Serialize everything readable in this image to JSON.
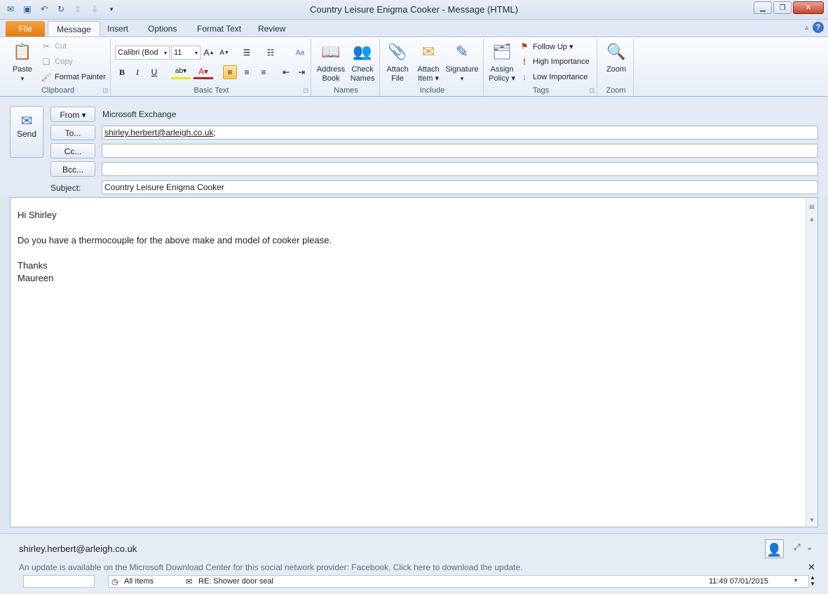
{
  "window": {
    "title": "Country Leisure Enigma Cooker  -  Message (HTML)"
  },
  "qat": {
    "icons": [
      "outlook-icon",
      "save-icon",
      "undo-icon",
      "redo-icon",
      "up-icon",
      "down-icon",
      "customize-icon"
    ]
  },
  "tabs": [
    {
      "label": "File"
    },
    {
      "label": "Message"
    },
    {
      "label": "Insert"
    },
    {
      "label": "Options"
    },
    {
      "label": "Format Text"
    },
    {
      "label": "Review"
    }
  ],
  "ribbon": {
    "clipboard": {
      "paste": "Paste",
      "cut": "Cut",
      "copy": "Copy",
      "format_painter": "Format Painter",
      "label": "Clipboard"
    },
    "basic_text": {
      "font": "Calibri (Bod",
      "size": "11",
      "label": "Basic Text"
    },
    "names": {
      "address_book_1": "Address",
      "address_book_2": "Book",
      "check_names_1": "Check",
      "check_names_2": "Names",
      "label": "Names"
    },
    "include": {
      "attach_file_1": "Attach",
      "attach_file_2": "File",
      "attach_item_1": "Attach",
      "attach_item_2": "Item ▾",
      "signature": "Signature",
      "label": "Include"
    },
    "tags": {
      "assign_policy_1": "Assign",
      "assign_policy_2": "Policy ▾",
      "follow_up": "Follow Up ▾",
      "high_importance": "High Importance",
      "low_importance": "Low Importance",
      "label": "Tags"
    },
    "zoom": {
      "zoom": "Zoom",
      "label": "Zoom"
    }
  },
  "compose": {
    "send": "Send",
    "from_button": "From ▾",
    "from_value": "Microsoft Exchange",
    "to_button": "To...",
    "to_value": "shirley.herbert@arleigh.co.uk",
    "to_suffix": ";",
    "cc_button": "Cc...",
    "cc_value": "",
    "bcc_button": "Bcc...",
    "bcc_value": "",
    "subject_label": "Subject:",
    "subject_value": "Country Leisure Enigma Cooker"
  },
  "body": {
    "lines": [
      "Hi Shirley",
      "",
      "Do you have a thermocouple for the above make and  model of cooker please.",
      "",
      "Thanks",
      "Maureen"
    ]
  },
  "people_pane": {
    "name": "shirley.herbert@arleigh.co.uk",
    "update_message": "An update is available on the Microsoft Download Center for this social network provider: Facebook. Click here to download the update.",
    "activity_filter": "All Items",
    "activity_item": "RE: Shower door seal",
    "activity_time": "11:49  07/01/2015"
  }
}
